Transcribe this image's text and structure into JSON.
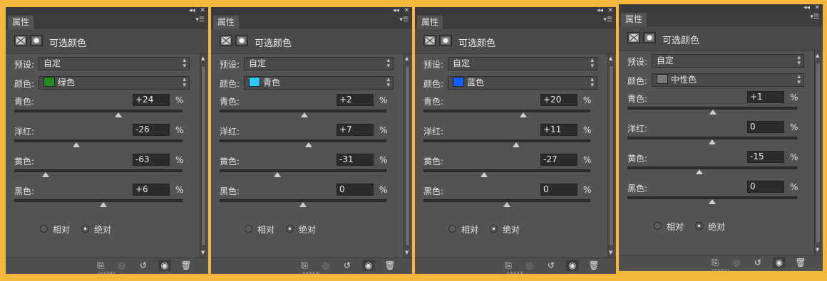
{
  "panels": [
    {
      "tab_label": "属性",
      "header_title": "可选颜色",
      "preset_label": "预设:",
      "preset_value": "自定",
      "color_label": "颜色:",
      "color_value": "绿色",
      "color_swatch": "#1f8f1f",
      "rows": [
        {
          "label": "青色:",
          "value": "+24",
          "pct": "%",
          "level": 24
        },
        {
          "label": "洋红:",
          "value": "-26",
          "pct": "%",
          "level": -26
        },
        {
          "label": "黄色:",
          "value": "-63",
          "pct": "%",
          "level": -63
        },
        {
          "label": "黑色:",
          "value": "+6",
          "pct": "%",
          "level": 6
        }
      ],
      "radio_relative": "相对",
      "radio_absolute": "绝对"
    },
    {
      "tab_label": "属性",
      "header_title": "可选颜色",
      "preset_label": "预设:",
      "preset_value": "自定",
      "color_label": "颜色:",
      "color_value": "青色",
      "color_swatch": "#2fc7ff",
      "rows": [
        {
          "label": "青色:",
          "value": "+2",
          "pct": "%",
          "level": 2
        },
        {
          "label": "洋红:",
          "value": "+7",
          "pct": "%",
          "level": 7
        },
        {
          "label": "黄色:",
          "value": "-31",
          "pct": "%",
          "level": -31
        },
        {
          "label": "黑色:",
          "value": "0",
          "pct": "%",
          "level": 0
        }
      ],
      "radio_relative": "相对",
      "radio_absolute": "绝对"
    },
    {
      "tab_label": "属性",
      "header_title": "可选颜色",
      "preset_label": "预设:",
      "preset_value": "自定",
      "color_label": "颜色:",
      "color_value": "蓝色",
      "color_swatch": "#1560ff",
      "rows": [
        {
          "label": "青色:",
          "value": "+20",
          "pct": "%",
          "level": 20
        },
        {
          "label": "洋红:",
          "value": "+11",
          "pct": "%",
          "level": 11
        },
        {
          "label": "黄色:",
          "value": "-27",
          "pct": "%",
          "level": -27
        },
        {
          "label": "黑色:",
          "value": "0",
          "pct": "%",
          "level": 0
        }
      ],
      "radio_relative": "相对",
      "radio_absolute": "绝对"
    },
    {
      "tab_label": "属性",
      "header_title": "可选颜色",
      "preset_label": "预设:",
      "preset_value": "自定",
      "color_label": "颜色:",
      "color_value": "中性色",
      "color_swatch": "#7a7a7a",
      "rows": [
        {
          "label": "青色:",
          "value": "+1",
          "pct": "%",
          "level": 1
        },
        {
          "label": "洋红:",
          "value": "0",
          "pct": "%",
          "level": 0
        },
        {
          "label": "黄色:",
          "value": "-15",
          "pct": "%",
          "level": -15
        },
        {
          "label": "黑色:",
          "value": "0",
          "pct": "%",
          "level": 0
        }
      ],
      "radio_relative": "相对",
      "radio_absolute": "绝对"
    }
  ],
  "selected_mode": "绝对",
  "footer_icons": [
    "clip-to-layer-icon",
    "view-previous-state-icon",
    "reset-icon",
    "visibility-eye-icon",
    "trash-icon"
  ],
  "top_controls": {
    "collapse": "◂◂",
    "close": "✕"
  },
  "tab_menu": "▾☰"
}
